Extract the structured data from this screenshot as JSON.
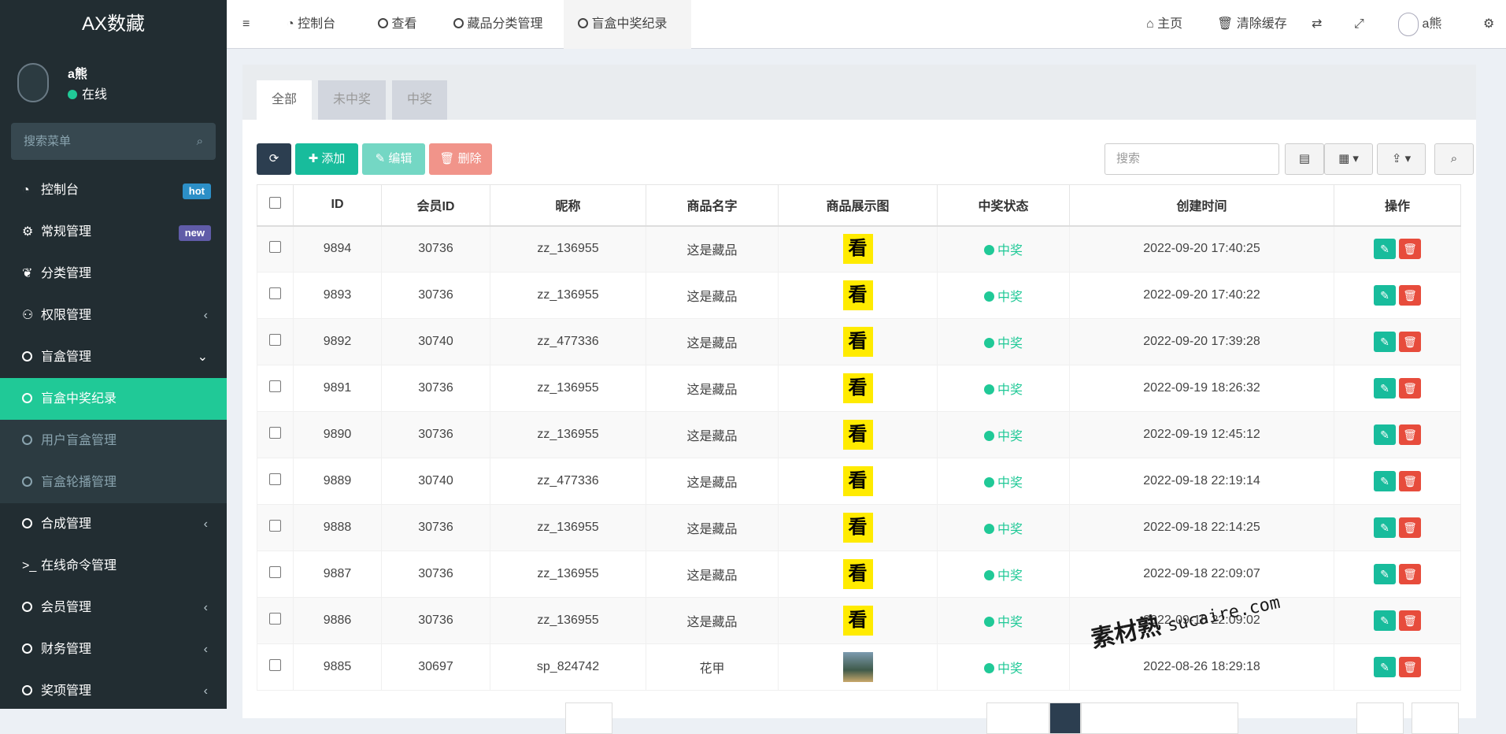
{
  "app": {
    "title": "AX数藏"
  },
  "user": {
    "name": "a熊",
    "status": "在线"
  },
  "sidebar": {
    "search_placeholder": "搜索菜单",
    "items": [
      {
        "label": "控制台",
        "badge": "hot",
        "badge_color": "#2c8fc7"
      },
      {
        "label": "常规管理",
        "badge": "new",
        "badge_color": "#605ca8"
      },
      {
        "label": "分类管理"
      },
      {
        "label": "权限管理"
      },
      {
        "label": "盲盒管理"
      },
      {
        "label": "盲盒中奖纪录"
      },
      {
        "label": "用户盲盒管理"
      },
      {
        "label": "盲盒轮播管理"
      },
      {
        "label": "合成管理"
      },
      {
        "label": "在线命令管理"
      },
      {
        "label": "会员管理"
      },
      {
        "label": "财务管理"
      },
      {
        "label": "奖项管理"
      }
    ]
  },
  "topbar": {
    "tabs": [
      "控制台",
      "查看",
      "藏品分类管理",
      "盲盒中奖纪录"
    ],
    "home": "主页",
    "clear_cache": "清除缓存",
    "user_name": "a熊"
  },
  "filter_tabs": [
    "全部",
    "未中奖",
    "中奖"
  ],
  "toolbar": {
    "add": "添加",
    "edit": "编辑",
    "delete": "删除",
    "search_placeholder": "搜索"
  },
  "table": {
    "columns": [
      "ID",
      "会员ID",
      "昵称",
      "商品名字",
      "商品展示图",
      "中奖状态",
      "创建时间",
      "操作"
    ],
    "thumb_char": "看",
    "rows": [
      {
        "id": "9894",
        "member": "30736",
        "nick": "zz_136955",
        "goods": "这是藏品",
        "status": "中奖",
        "time": "2022-09-20 17:40:25"
      },
      {
        "id": "9893",
        "member": "30736",
        "nick": "zz_136955",
        "goods": "这是藏品",
        "status": "中奖",
        "time": "2022-09-20 17:40:22"
      },
      {
        "id": "9892",
        "member": "30740",
        "nick": "zz_477336",
        "goods": "这是藏品",
        "status": "中奖",
        "time": "2022-09-20 17:39:28"
      },
      {
        "id": "9891",
        "member": "30736",
        "nick": "zz_136955",
        "goods": "这是藏品",
        "status": "中奖",
        "time": "2022-09-19 18:26:32"
      },
      {
        "id": "9890",
        "member": "30736",
        "nick": "zz_136955",
        "goods": "这是藏品",
        "status": "中奖",
        "time": "2022-09-19 12:45:12"
      },
      {
        "id": "9889",
        "member": "30740",
        "nick": "zz_477336",
        "goods": "这是藏品",
        "status": "中奖",
        "time": "2022-09-18 22:19:14"
      },
      {
        "id": "9888",
        "member": "30736",
        "nick": "zz_136955",
        "goods": "这是藏品",
        "status": "中奖",
        "time": "2022-09-18 22:14:25"
      },
      {
        "id": "9887",
        "member": "30736",
        "nick": "zz_136955",
        "goods": "这是藏品",
        "status": "中奖",
        "time": "2022-09-18 22:09:07"
      },
      {
        "id": "9886",
        "member": "30736",
        "nick": "zz_136955",
        "goods": "这是藏品",
        "status": "中奖",
        "time": "2022-09-18 22:09:02"
      },
      {
        "id": "9885",
        "member": "30697",
        "nick": "sp_824742",
        "goods": "花甲",
        "status": "中奖",
        "time": "2022-08-26 18:29:18"
      }
    ]
  },
  "watermark": {
    "main": "素材熟",
    "url": "sucaire.com"
  },
  "colors": {
    "accent": "#20c997",
    "sidebar": "#222d32",
    "danger": "#e74c3c"
  }
}
